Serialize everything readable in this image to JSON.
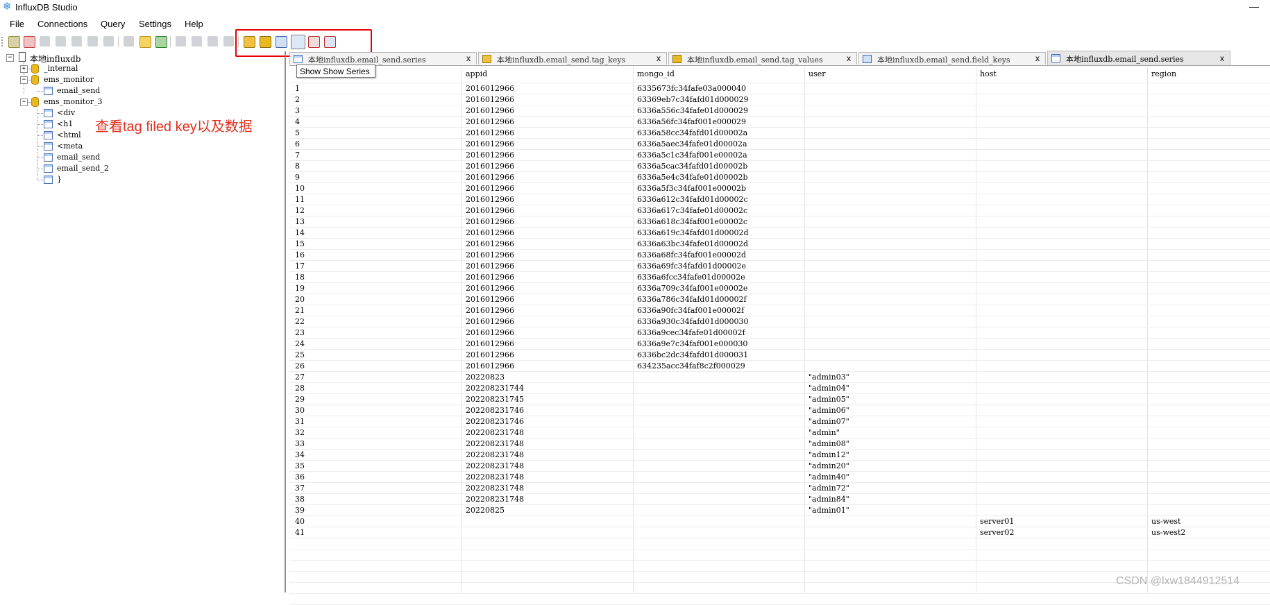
{
  "window": {
    "title": "InfluxDB Studio",
    "minimize": "—"
  },
  "menu": [
    "File",
    "Connections",
    "Query",
    "Settings",
    "Help"
  ],
  "tooltip": "Show Show Series",
  "annotation": "查看tag filed key以及数据",
  "tree": {
    "root": "本地influxdb",
    "nodes": [
      "_internal",
      "ems_monitor",
      "email_send",
      "ems_monitor_3",
      "<div",
      "<h1",
      "<html",
      "<meta",
      "email_send",
      "email_send_2",
      "}"
    ]
  },
  "tabs": [
    {
      "label": "本地influxdb.email_send.series",
      "close": "x"
    },
    {
      "label": "本地influxdb.email_send.tag_keys",
      "close": "x"
    },
    {
      "label": "本地influxdb.email_send.tag_values",
      "close": "x"
    },
    {
      "label": "本地influxdb.email_send.field_keys",
      "close": "x"
    },
    {
      "label": "本地influxdb.email_send.series",
      "close": "x"
    }
  ],
  "grid": {
    "columns": [
      "appid",
      "mongo_id",
      "user",
      "host",
      "region"
    ],
    "rows": [
      [
        "1",
        "2016012966",
        "6335673fc34fafe03a000040",
        "",
        "",
        ""
      ],
      [
        "2",
        "2016012966",
        "63369eb7c34fafd01d000029",
        "",
        "",
        ""
      ],
      [
        "3",
        "2016012966",
        "6336a556c34fafe01d000029",
        "",
        "",
        ""
      ],
      [
        "4",
        "2016012966",
        "6336a56fc34faf001e000029",
        "",
        "",
        ""
      ],
      [
        "5",
        "2016012966",
        "6336a58cc34fafd01d00002a",
        "",
        "",
        ""
      ],
      [
        "6",
        "2016012966",
        "6336a5aec34fafe01d00002a",
        "",
        "",
        ""
      ],
      [
        "7",
        "2016012966",
        "6336a5c1c34faf001e00002a",
        "",
        "",
        ""
      ],
      [
        "8",
        "2016012966",
        "6336a5cac34fafd01d00002b",
        "",
        "",
        ""
      ],
      [
        "9",
        "2016012966",
        "6336a5e4c34fafe01d00002b",
        "",
        "",
        ""
      ],
      [
        "10",
        "2016012966",
        "6336a5f3c34faf001e00002b",
        "",
        "",
        ""
      ],
      [
        "11",
        "2016012966",
        "6336a612c34fafd01d00002c",
        "",
        "",
        ""
      ],
      [
        "12",
        "2016012966",
        "6336a617c34fafe01d00002c",
        "",
        "",
        ""
      ],
      [
        "13",
        "2016012966",
        "6336a618c34faf001e00002c",
        "",
        "",
        ""
      ],
      [
        "14",
        "2016012966",
        "6336a619c34fafd01d00002d",
        "",
        "",
        ""
      ],
      [
        "15",
        "2016012966",
        "6336a63bc34fafe01d00002d",
        "",
        "",
        ""
      ],
      [
        "16",
        "2016012966",
        "6336a68fc34faf001e00002d",
        "",
        "",
        ""
      ],
      [
        "17",
        "2016012966",
        "6336a69fc34fafd01d00002e",
        "",
        "",
        ""
      ],
      [
        "18",
        "2016012966",
        "6336a6fcc34fafe01d00002e",
        "",
        "",
        ""
      ],
      [
        "19",
        "2016012966",
        "6336a709c34faf001e00002e",
        "",
        "",
        ""
      ],
      [
        "20",
        "2016012966",
        "6336a786c34fafd01d00002f",
        "",
        "",
        ""
      ],
      [
        "21",
        "2016012966",
        "6336a90fc34faf001e00002f",
        "",
        "",
        ""
      ],
      [
        "22",
        "2016012966",
        "6336a930c34fafd01d000030",
        "",
        "",
        ""
      ],
      [
        "23",
        "2016012966",
        "6336a9cec34fafe01d00002f",
        "",
        "",
        ""
      ],
      [
        "24",
        "2016012966",
        "6336a9e7c34faf001e000030",
        "",
        "",
        ""
      ],
      [
        "25",
        "2016012966",
        "6336bc2dc34fafd01d000031",
        "",
        "",
        ""
      ],
      [
        "26",
        "2016012966",
        "634235acc34faf8c2f000029",
        "",
        "",
        ""
      ],
      [
        "27",
        "20220823",
        "",
        "\"admin03\"",
        "",
        ""
      ],
      [
        "28",
        "202208231744",
        "",
        "\"admin04\"",
        "",
        ""
      ],
      [
        "29",
        "202208231745",
        "",
        "\"admin05\"",
        "",
        ""
      ],
      [
        "30",
        "202208231746",
        "",
        "\"admin06\"",
        "",
        ""
      ],
      [
        "31",
        "202208231746",
        "",
        "\"admin07\"",
        "",
        ""
      ],
      [
        "32",
        "202208231748",
        "",
        "\"admin\"",
        "",
        ""
      ],
      [
        "33",
        "202208231748",
        "",
        "\"admin08\"",
        "",
        ""
      ],
      [
        "34",
        "202208231748",
        "",
        "\"admin12\"",
        "",
        ""
      ],
      [
        "35",
        "202208231748",
        "",
        "\"admin20\"",
        "",
        ""
      ],
      [
        "36",
        "202208231748",
        "",
        "\"admin40\"",
        "",
        ""
      ],
      [
        "37",
        "202208231748",
        "",
        "\"admin72\"",
        "",
        ""
      ],
      [
        "38",
        "202208231748",
        "",
        "\"admin84\"",
        "",
        ""
      ],
      [
        "39",
        "20220825",
        "",
        "\"admin01\"",
        "",
        ""
      ],
      [
        "40",
        "",
        "",
        "",
        "server01",
        "us-west"
      ],
      [
        "41",
        "",
        "",
        "",
        "server02",
        "us-west2"
      ]
    ]
  },
  "watermark": "CSDN @lxw1844912514",
  "colors": {
    "highlight": "#e60000",
    "annotation": "#e0301e",
    "db_icon": "#e8b923",
    "table_icon": "#4a72b8"
  },
  "toolbar_icons": [
    "new-query-icon",
    "delete-icon",
    "refresh-icon",
    "users-icon",
    "stats-icon",
    "diagnostics-icon",
    "backfill-icon",
    "reload-icon",
    "run-icon",
    "run-query-icon",
    "copy-icon",
    "copy2-icon",
    "paste-icon",
    "close-tab-icon",
    "tag-keys-icon",
    "tag-values-icon",
    "field-keys-icon",
    "series-icon",
    "drop-series-icon",
    "drop-measurement-icon"
  ]
}
